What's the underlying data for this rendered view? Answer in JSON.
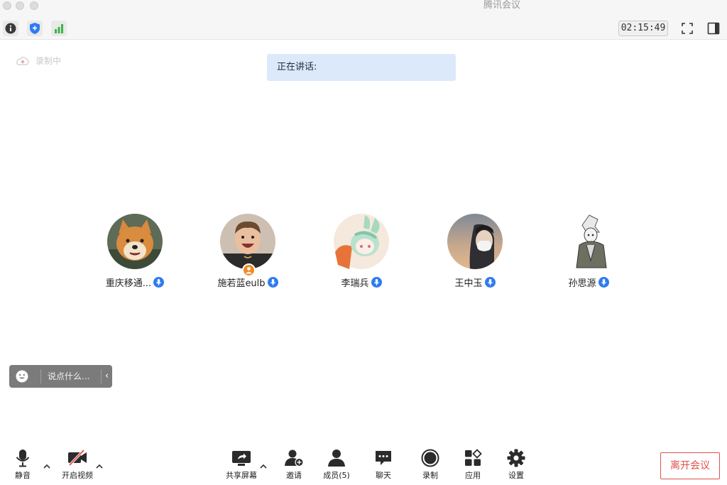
{
  "window": {
    "title": "腾讯会议"
  },
  "toolbar": {
    "timer": "02:15:49",
    "icons": [
      "info-icon",
      "shield-icon",
      "signal-icon",
      "fullscreen-icon",
      "sidebar-toggle-icon"
    ]
  },
  "recording": {
    "label": "录制中"
  },
  "speaking": {
    "label": "正在讲话:"
  },
  "participants": [
    {
      "name": "重庆移通...",
      "mic": "mic-icon"
    },
    {
      "name": "施若蓝eulb",
      "mic": "mic-icon",
      "host": true
    },
    {
      "name": "李瑞兵",
      "mic": "mic-icon"
    },
    {
      "name": "王中玉",
      "mic": "mic-icon"
    },
    {
      "name": "孙思源",
      "mic": "mic-icon"
    }
  ],
  "chat": {
    "placeholder": "说点什么..."
  },
  "bottom_bar": {
    "mute": "静音",
    "video": "开启视频",
    "share": "共享屏幕",
    "invite": "邀请",
    "members": "成员(5)",
    "chat": "聊天",
    "record": "录制",
    "apps": "应用",
    "settings": "设置",
    "leave": "离开会议"
  },
  "colors": {
    "accent_blue": "#2f7bf0",
    "banner_bg": "#dce9fb",
    "leave_red": "#e2514c"
  }
}
